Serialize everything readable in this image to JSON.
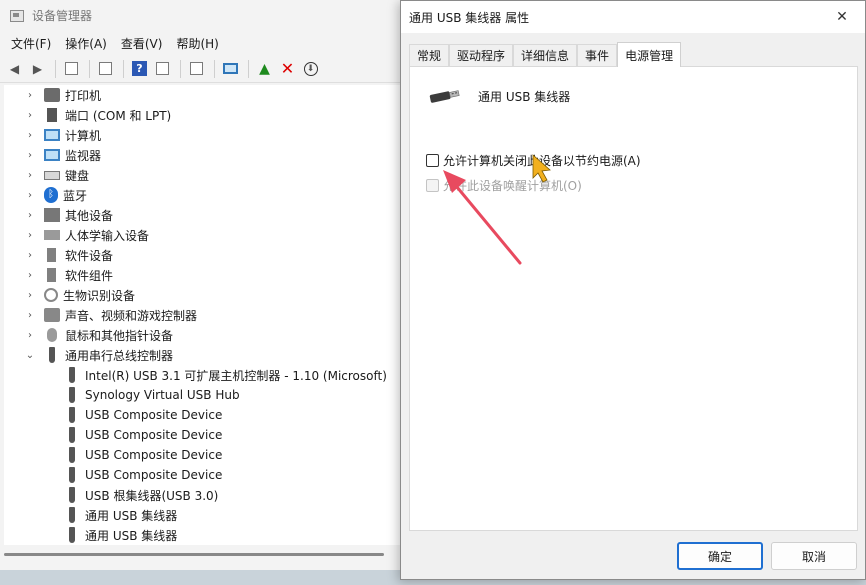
{
  "device_manager": {
    "title": "设备管理器",
    "menu": [
      "文件(F)",
      "操作(A)",
      "查看(V)",
      "帮助(H)"
    ],
    "tree": [
      {
        "label": "打印机",
        "icon": "printer-icon",
        "expanded": false
      },
      {
        "label": "端口 (COM 和 LPT)",
        "icon": "port-icon",
        "expanded": false
      },
      {
        "label": "计算机",
        "icon": "computer-icon",
        "expanded": false
      },
      {
        "label": "监视器",
        "icon": "monitor-icon",
        "expanded": false
      },
      {
        "label": "键盘",
        "icon": "keyboard-icon",
        "expanded": false
      },
      {
        "label": "蓝牙",
        "icon": "bluetooth-icon",
        "expanded": false
      },
      {
        "label": "其他设备",
        "icon": "other-device-icon",
        "expanded": false
      },
      {
        "label": "人体学输入设备",
        "icon": "hid-icon",
        "expanded": false
      },
      {
        "label": "软件设备",
        "icon": "software-device-icon",
        "expanded": false
      },
      {
        "label": "软件组件",
        "icon": "software-component-icon",
        "expanded": false
      },
      {
        "label": "生物识别设备",
        "icon": "biometric-icon",
        "expanded": false
      },
      {
        "label": "声音、视频和游戏控制器",
        "icon": "audio-icon",
        "expanded": false
      },
      {
        "label": "鼠标和其他指针设备",
        "icon": "mouse-icon",
        "expanded": false
      },
      {
        "label": "通用串行总线控制器",
        "icon": "usb-icon",
        "expanded": true
      },
      {
        "label": "Intel(R) USB 3.1 可扩展主机控制器 - 1.10 (Microsoft)",
        "icon": "usb-icon",
        "child": true
      },
      {
        "label": "Synology Virtual USB Hub",
        "icon": "usb-icon",
        "child": true
      },
      {
        "label": "USB Composite Device",
        "icon": "usb-icon",
        "child": true
      },
      {
        "label": "USB Composite Device",
        "icon": "usb-icon",
        "child": true
      },
      {
        "label": "USB Composite Device",
        "icon": "usb-icon",
        "child": true
      },
      {
        "label": "USB Composite Device",
        "icon": "usb-icon",
        "child": true
      },
      {
        "label": "USB 根集线器(USB 3.0)",
        "icon": "usb-icon",
        "child": true
      },
      {
        "label": "通用 USB 集线器",
        "icon": "usb-icon",
        "child": true
      },
      {
        "label": "通用 USB 集线器",
        "icon": "usb-icon",
        "child": true
      }
    ]
  },
  "dialog": {
    "title": "通用 USB 集线器 属性",
    "close_symbol": "✕",
    "tabs": [
      "常规",
      "驱动程序",
      "详细信息",
      "事件",
      "电源管理"
    ],
    "active_tab": 4,
    "device_name": "通用 USB 集线器",
    "options": [
      {
        "label": "允许计算机关闭此设备以节约电源(A)",
        "checked": false,
        "enabled": true
      },
      {
        "label": "允许此设备唤醒计算机(O)",
        "checked": false,
        "enabled": false
      }
    ],
    "ok_label": "确定",
    "cancel_label": "取消"
  },
  "colors": {
    "accent": "#1f6fd1",
    "annotation_arrow": "#e84a5f",
    "cursor": "#f2b01e"
  }
}
